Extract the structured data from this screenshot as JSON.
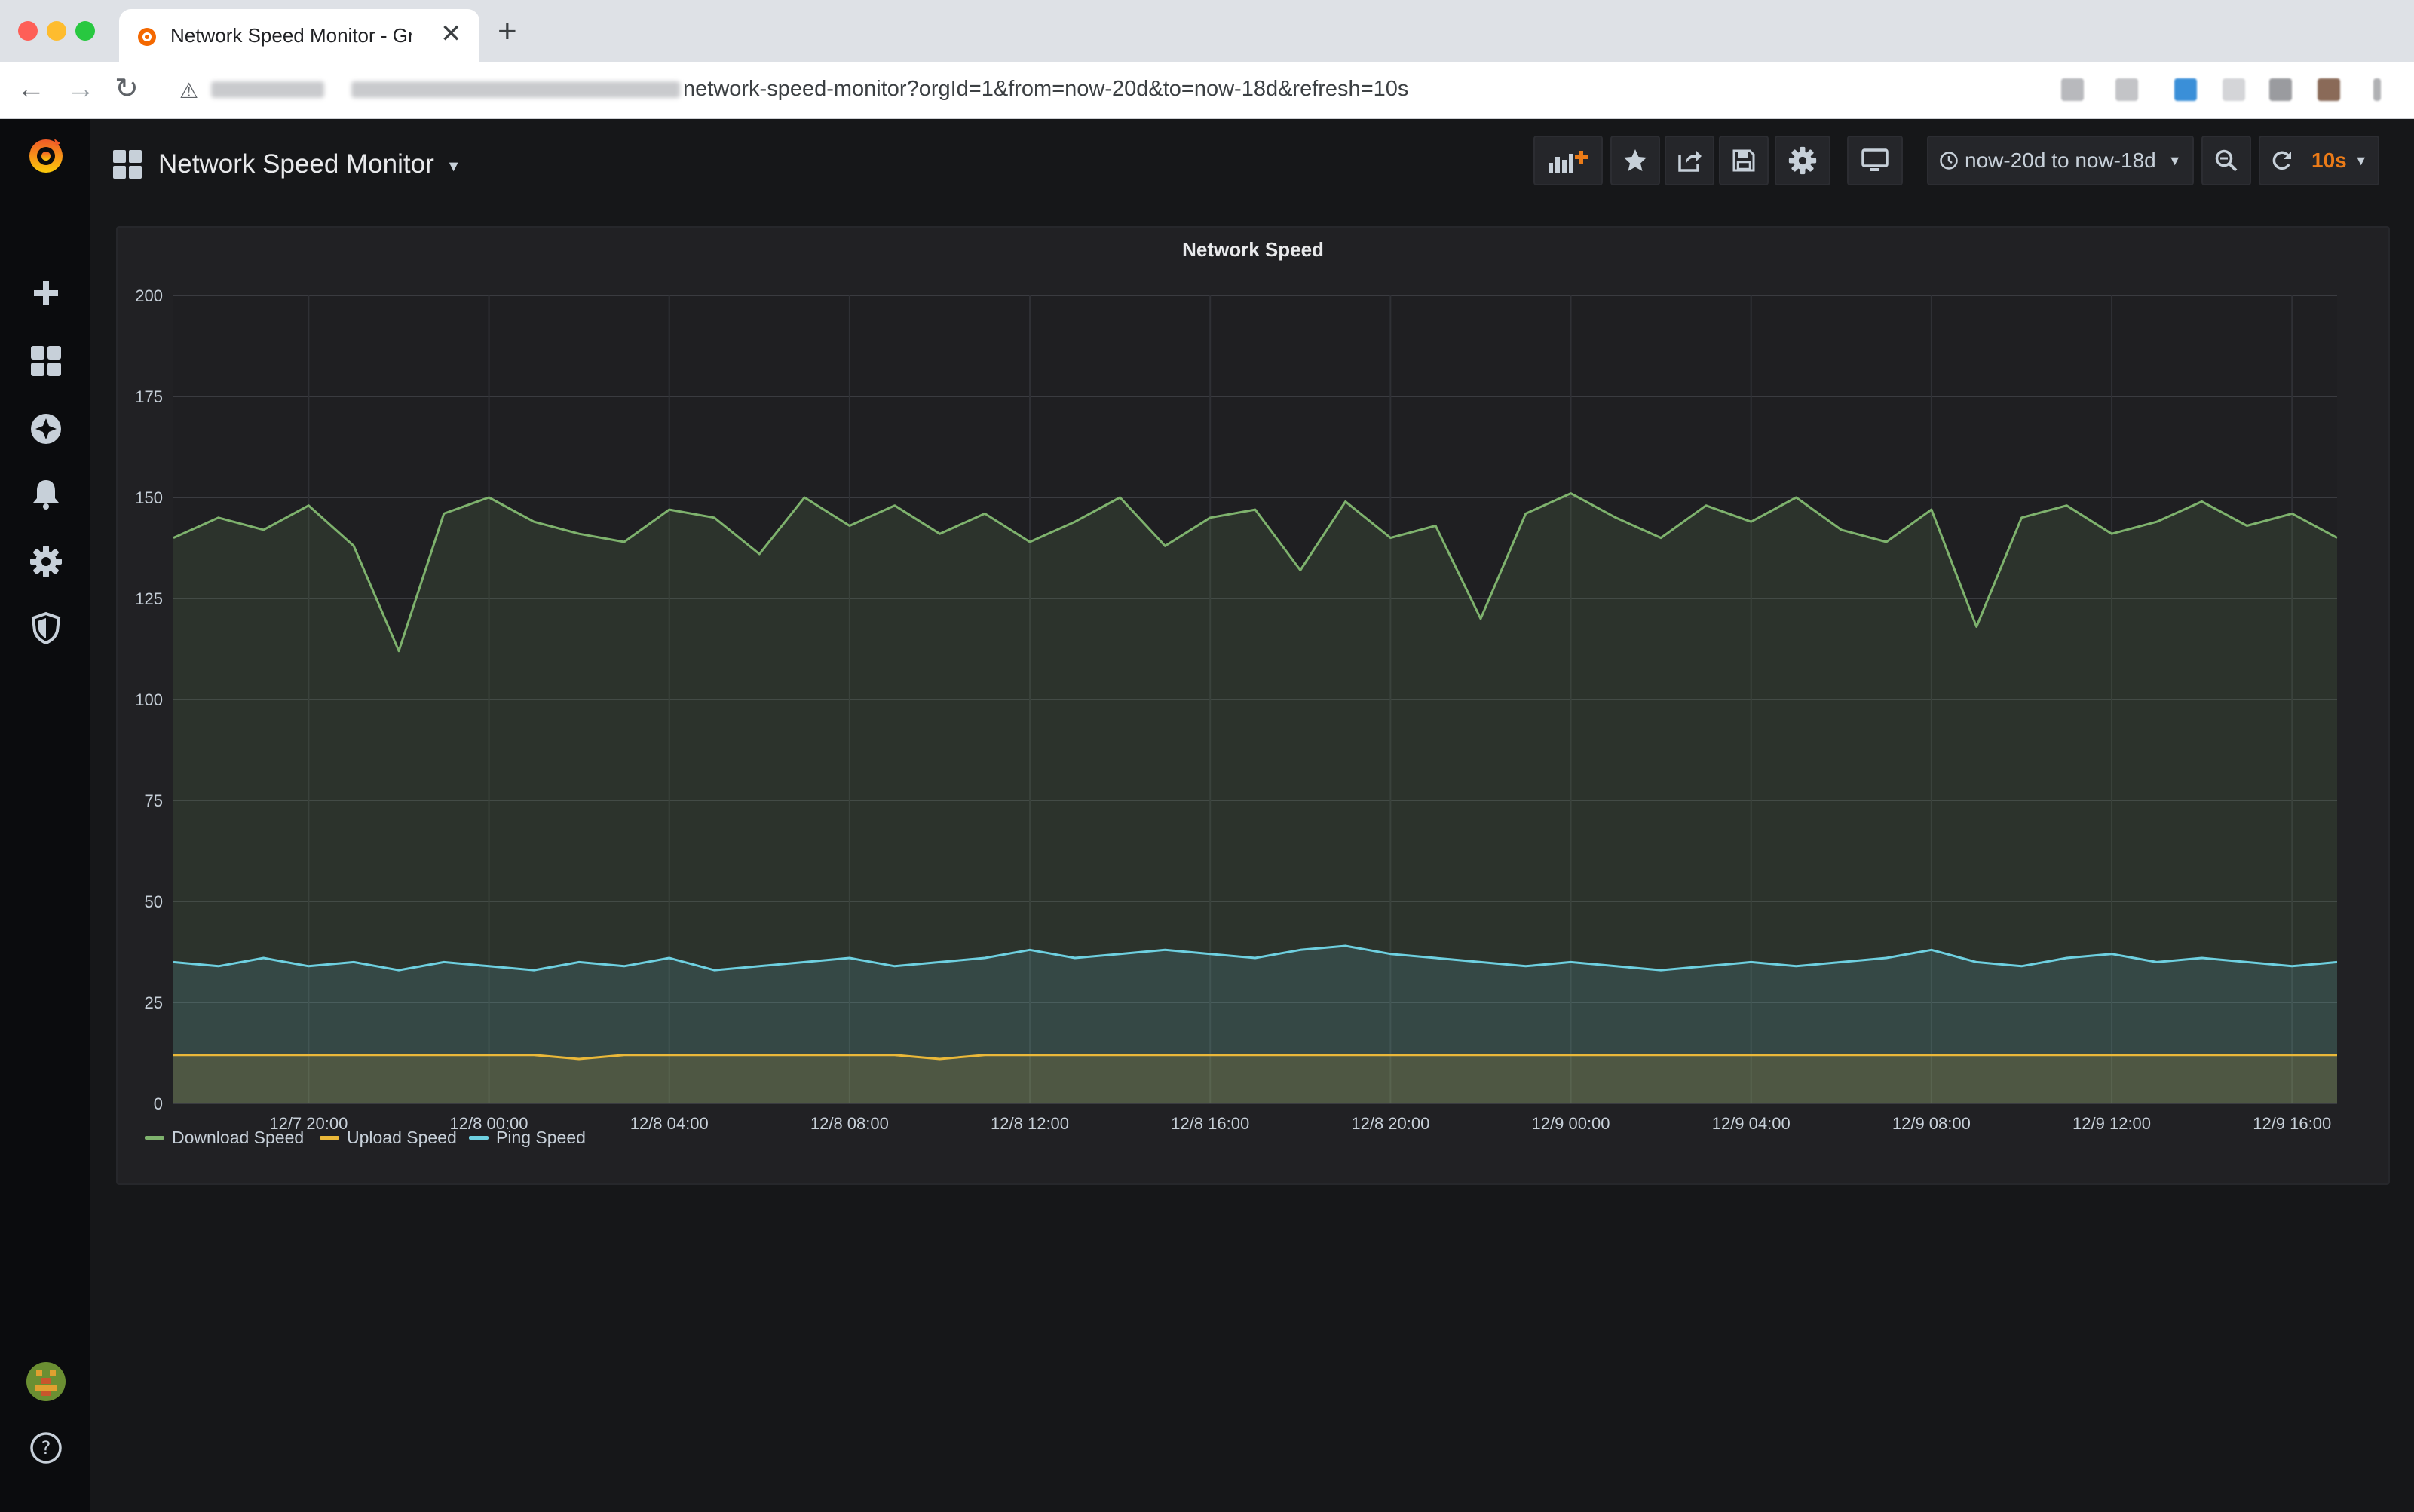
{
  "browser": {
    "tab_title": "Network Speed Monitor - Grafana",
    "tab_close": "✕",
    "new_tab": "+",
    "url": "network-speed-monitor?orgId=1&from=now-20d&to=now-18d&refresh=10s"
  },
  "dashboard": {
    "title": "Network Speed Monitor",
    "time_range": "now-20d to now-18d",
    "refresh_interval": "10s"
  },
  "icons": {
    "sidemenu": [
      "grafana-logo-icon",
      "plus-icon",
      "dashboards-icon",
      "explore-icon",
      "bell-icon",
      "gear-icon",
      "shield-icon",
      "avatar",
      "help-icon"
    ],
    "toolbar": [
      "add-panel-icon",
      "star-icon",
      "share-icon",
      "save-icon",
      "gear-icon",
      "tv-icon",
      "clock-icon",
      "zoom-out-icon",
      "refresh-icon"
    ]
  },
  "colors": {
    "download": "#7eb26d",
    "upload": "#eab839",
    "ping": "#6ed0e0",
    "accent": "#eb7b18"
  },
  "panel": {
    "title": "Network Speed"
  },
  "chart_data": {
    "type": "line",
    "title": "Network Speed",
    "xlabel": "",
    "ylabel": "",
    "ylim": [
      0,
      200
    ],
    "y_ticks": [
      0,
      25,
      50,
      75,
      100,
      125,
      150,
      175,
      200
    ],
    "x_ticks": [
      "12/7 20:00",
      "12/8 00:00",
      "12/8 04:00",
      "12/8 08:00",
      "12/8 12:00",
      "12/8 16:00",
      "12/8 20:00",
      "12/9 00:00",
      "12/9 04:00",
      "12/9 08:00",
      "12/9 12:00",
      "12/9 16:00"
    ],
    "grid": true,
    "legend": "bottom-left",
    "x_samples": [
      "12/7 17:00",
      "12/7 18:00",
      "12/7 19:00",
      "12/7 20:00",
      "12/7 21:00",
      "12/7 22:00",
      "12/7 23:00",
      "12/8 00:00",
      "12/8 01:00",
      "12/8 02:00",
      "12/8 03:00",
      "12/8 04:00",
      "12/8 05:00",
      "12/8 06:00",
      "12/8 07:00",
      "12/8 08:00",
      "12/8 09:00",
      "12/8 10:00",
      "12/8 11:00",
      "12/8 12:00",
      "12/8 13:00",
      "12/8 14:00",
      "12/8 15:00",
      "12/8 16:00",
      "12/8 17:00",
      "12/8 18:00",
      "12/8 19:00",
      "12/8 20:00",
      "12/8 21:00",
      "12/8 22:00",
      "12/8 23:00",
      "12/9 00:00",
      "12/9 01:00",
      "12/9 02:00",
      "12/9 03:00",
      "12/9 04:00",
      "12/9 05:00",
      "12/9 06:00",
      "12/9 07:00",
      "12/9 08:00",
      "12/9 09:00",
      "12/9 10:00",
      "12/9 11:00",
      "12/9 12:00",
      "12/9 13:00",
      "12/9 14:00",
      "12/9 15:00",
      "12/9 16:00",
      "12/9 17:00"
    ],
    "series": [
      {
        "name": "Download Speed",
        "color": "#7eb26d",
        "values": [
          140,
          145,
          142,
          148,
          138,
          112,
          146,
          150,
          144,
          141,
          139,
          147,
          145,
          136,
          150,
          143,
          148,
          141,
          146,
          139,
          144,
          150,
          138,
          145,
          147,
          132,
          149,
          140,
          143,
          120,
          146,
          151,
          145,
          140,
          148,
          144,
          150,
          142,
          139,
          147,
          118,
          145,
          148,
          141,
          144,
          149,
          143,
          146,
          140
        ]
      },
      {
        "name": "Upload Speed",
        "color": "#eab839",
        "values": [
          12,
          12,
          12,
          12,
          12,
          12,
          12,
          12,
          12,
          11,
          12,
          12,
          12,
          12,
          12,
          12,
          12,
          11,
          12,
          12,
          12,
          12,
          12,
          12,
          12,
          12,
          12,
          12,
          12,
          12,
          12,
          12,
          12,
          12,
          12,
          12,
          12,
          12,
          12,
          12,
          12,
          12,
          12,
          12,
          12,
          12,
          12,
          12,
          12
        ]
      },
      {
        "name": "Ping Speed",
        "color": "#6ed0e0",
        "values": [
          35,
          34,
          36,
          34,
          35,
          33,
          35,
          34,
          33,
          35,
          34,
          36,
          33,
          34,
          35,
          36,
          34,
          35,
          36,
          38,
          36,
          37,
          38,
          37,
          36,
          38,
          39,
          37,
          36,
          35,
          34,
          35,
          34,
          33,
          34,
          35,
          34,
          35,
          36,
          38,
          35,
          34,
          36,
          37,
          35,
          36,
          35,
          34,
          35
        ]
      }
    ]
  }
}
